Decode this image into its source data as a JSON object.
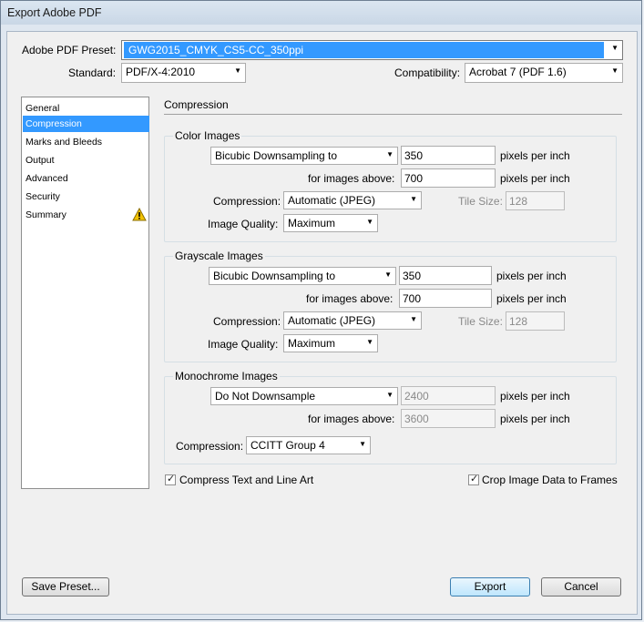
{
  "window": {
    "title": "Export Adobe PDF"
  },
  "preset": {
    "label": "Adobe PDF Preset:",
    "value": "GWG2015_CMYK_CS5-CC_350ppi"
  },
  "standard": {
    "label": "Standard:",
    "value": "PDF/X-4:2010"
  },
  "compatibility": {
    "label": "Compatibility:",
    "value": "Acrobat 7 (PDF 1.6)"
  },
  "sidebar": {
    "items": [
      {
        "label": "General"
      },
      {
        "label": "Compression"
      },
      {
        "label": "Marks and Bleeds"
      },
      {
        "label": "Output"
      },
      {
        "label": "Advanced"
      },
      {
        "label": "Security"
      },
      {
        "label": "Summary"
      }
    ],
    "warning_icon": "warning-icon"
  },
  "section_title": "Compression",
  "color_images": {
    "heading": "Color Images",
    "sampling": "Bicubic Downsampling to",
    "ppi": "350",
    "ppi_unit": "pixels per inch",
    "above_label": "for images above:",
    "above": "700",
    "above_unit": "pixels per inch",
    "compression_label": "Compression:",
    "compression": "Automatic (JPEG)",
    "tile_label": "Tile Size:",
    "tile": "128",
    "quality_label": "Image Quality:",
    "quality": "Maximum"
  },
  "grayscale_images": {
    "heading": "Grayscale Images",
    "sampling": "Bicubic Downsampling to",
    "ppi": "350",
    "ppi_unit": "pixels per inch",
    "above_label": "for images above:",
    "above": "700",
    "above_unit": "pixels per inch",
    "compression_label": "Compression:",
    "compression": "Automatic (JPEG)",
    "tile_label": "Tile Size:",
    "tile": "128",
    "quality_label": "Image Quality:",
    "quality": "Maximum"
  },
  "monochrome_images": {
    "heading": "Monochrome Images",
    "sampling": "Do Not Downsample",
    "ppi": "2400",
    "ppi_unit": "pixels per inch",
    "above_label": "for images above:",
    "above": "3600",
    "above_unit": "pixels per inch",
    "compression_label": "Compression:",
    "compression": "CCITT Group 4"
  },
  "options": {
    "compress_text": {
      "label": "Compress Text and Line Art",
      "checked": true
    },
    "crop_images": {
      "label": "Crop Image Data to Frames",
      "checked": true
    }
  },
  "buttons": {
    "save_preset": "Save Preset...",
    "export": "Export",
    "cancel": "Cancel"
  },
  "colors": {
    "selection": "#3399ff",
    "warning": "#f2c200"
  }
}
